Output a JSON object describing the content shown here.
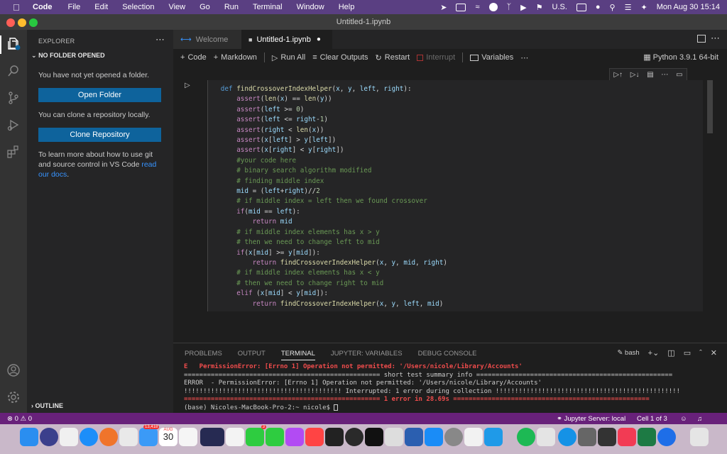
{
  "menubar": {
    "app": "Code",
    "items": [
      "File",
      "Edit",
      "Selection",
      "View",
      "Go",
      "Run",
      "Terminal",
      "Window",
      "Help"
    ],
    "locale": "U.S.",
    "datetime": "Mon Aug 30  15:14"
  },
  "window": {
    "title": "Untitled-1.ipynb"
  },
  "sidebar": {
    "header": "EXPLORER",
    "section": "NO FOLDER OPENED",
    "msg1": "You have not yet opened a folder.",
    "open_folder": "Open Folder",
    "msg2": "You can clone a repository locally.",
    "clone_repo": "Clone Repository",
    "msg3": "To learn more about how to use git and source control in VS Code ",
    "link": "read our docs",
    "msg3_end": ".",
    "outline": "OUTLINE"
  },
  "tabs": [
    {
      "label": "Welcome",
      "active": false
    },
    {
      "label": "Untitled-1.ipynb",
      "active": true
    }
  ],
  "toolbar": {
    "code": "Code",
    "markdown": "Markdown",
    "run_all": "Run All",
    "clear_outputs": "Clear Outputs",
    "restart": "Restart",
    "interrupt": "Interrupt",
    "variables": "Variables",
    "kernel": "Python 3.9.1 64-bit"
  },
  "panel": {
    "tabs": [
      "PROBLEMS",
      "OUTPUT",
      "TERMINAL",
      "JUPYTER: VARIABLES",
      "DEBUG CONSOLE"
    ],
    "active_tab": "TERMINAL",
    "shell": "bash",
    "lines": [
      "E   PermissionError: [Errno 1] Operation not permitted: '/Users/nicole/Library/Accounts'",
      "=================================================== short test summary info ===================================================",
      "ERROR  - PermissionError: [Errno 1] Operation not permitted: '/Users/nicole/Library/Accounts'",
      "!!!!!!!!!!!!!!!!!!!!!!!!!!!!!!!!!!!!!!!!! Interrupted: 1 error during collection !!!!!!!!!!!!!!!!!!!!!!!!!!!!!!!!!!!!!!!!!!!!!!!!",
      "=================================================== 1 error in 28.69s ===================================================",
      "(base) Nicoles-MacBook-Pro-2:~ nicole$ "
    ]
  },
  "statusbar": {
    "errors": "0",
    "warnings": "0",
    "jupyter": "Jupyter Server: local",
    "cell": "Cell 1 of 3"
  },
  "dock": {
    "calendar_month": "AUG",
    "calendar_day": "30",
    "mail_badge": "13,418",
    "messages_badge": "3"
  }
}
